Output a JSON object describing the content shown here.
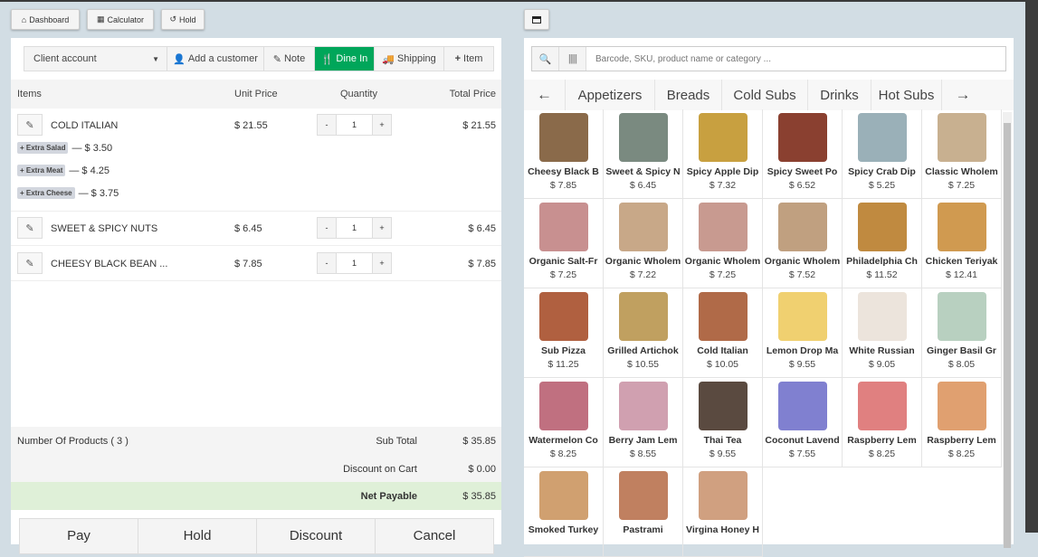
{
  "top_buttons": {
    "dashboard": "Dashboard",
    "calculator": "Calculator",
    "hold": "Hold"
  },
  "toolbar": {
    "client": "Client account",
    "add_customer": "Add a customer",
    "note": "Note",
    "dine_in": "Dine In",
    "shipping": "Shipping",
    "item": "Item"
  },
  "cart_headers": {
    "items": "Items",
    "unit_price": "Unit Price",
    "quantity": "Quantity",
    "total_price": "Total Price"
  },
  "cart_items": [
    {
      "name": "COLD ITALIAN",
      "unit": "$ 21.55",
      "qty": "1",
      "total": "$ 21.55",
      "extras": [
        {
          "label": "+ Extra Salad",
          "price": "— $ 3.50"
        },
        {
          "label": "+ Extra Meat",
          "price": "— $ 4.25"
        },
        {
          "label": "+ Extra Cheese",
          "price": "— $ 3.75"
        }
      ]
    },
    {
      "name": "SWEET & SPICY NUTS",
      "unit": "$ 6.45",
      "qty": "1",
      "total": "$ 6.45"
    },
    {
      "name": "CHEESY BLACK BEAN ...",
      "unit": "$ 7.85",
      "qty": "1",
      "total": "$ 7.85"
    }
  ],
  "qty_minus": "-",
  "qty_plus": "+",
  "summary": {
    "num_products": "Number Of Products ( 3 )",
    "subtotal_label": "Sub Total",
    "subtotal": "$ 35.85",
    "discount_label": "Discount on Cart",
    "discount": "$ 0.00",
    "net_label": "Net Payable",
    "net": "$ 35.85"
  },
  "bottom_buttons": [
    "Pay",
    "Hold",
    "Discount",
    "Cancel"
  ],
  "search": {
    "placeholder": "Barcode, SKU, product name or category ..."
  },
  "categories": [
    "Appetizers",
    "Breads",
    "Cold Subs",
    "Drinks",
    "Hot Subs"
  ],
  "products": [
    {
      "name": "Cheesy Black B",
      "price": "$ 7.85",
      "color": "#8a6a4a"
    },
    {
      "name": "Sweet & Spicy N",
      "price": "$ 6.45",
      "color": "#7a8a80"
    },
    {
      "name": "Spicy Apple Dip",
      "price": "$ 7.32",
      "color": "#c8a040"
    },
    {
      "name": "Spicy Sweet Po",
      "price": "$ 6.52",
      "color": "#8a4030"
    },
    {
      "name": "Spicy Crab Dip",
      "price": "$ 5.25",
      "color": "#9ab0b8"
    },
    {
      "name": "Classic Wholem",
      "price": "$ 7.25",
      "color": "#c8b090"
    },
    {
      "name": "Organic Salt-Fr",
      "price": "$ 7.25",
      "color": "#c89090"
    },
    {
      "name": "Organic Wholem",
      "price": "$ 7.22",
      "color": "#c8a888"
    },
    {
      "name": "Organic Wholem",
      "price": "$ 7.25",
      "color": "#c89a90"
    },
    {
      "name": "Organic Wholem",
      "price": "$ 7.52",
      "color": "#c0a080"
    },
    {
      "name": "Philadelphia Ch",
      "price": "$ 11.52",
      "color": "#c08a40"
    },
    {
      "name": "Chicken Teriyak",
      "price": "$ 12.41",
      "color": "#d09a50"
    },
    {
      "name": "Sub Pizza",
      "price": "$ 11.25",
      "color": "#b06040"
    },
    {
      "name": "Grilled Artichok",
      "price": "$ 10.55",
      "color": "#c0a060"
    },
    {
      "name": "Cold Italian",
      "price": "$ 10.05",
      "color": "#b06a48"
    },
    {
      "name": "Lemon Drop Ma",
      "price": "$ 9.55",
      "color": "#f0d070"
    },
    {
      "name": "White Russian",
      "price": "$ 9.05",
      "color": "#ece4dc"
    },
    {
      "name": "Ginger Basil Gr",
      "price": "$ 8.05",
      "color": "#b8d0c0"
    },
    {
      "name": "Watermelon Co",
      "price": "$ 8.25",
      "color": "#c07080"
    },
    {
      "name": "Berry Jam Lem",
      "price": "$ 8.55",
      "color": "#d0a0b0"
    },
    {
      "name": "Thai Tea",
      "price": "$ 9.55",
      "color": "#5a4a40"
    },
    {
      "name": "Coconut Lavend",
      "price": "$ 7.55",
      "color": "#8080d0"
    },
    {
      "name": "Raspberry Lem",
      "price": "$ 8.25",
      "color": "#e08080"
    },
    {
      "name": "Raspberry Lem",
      "price": "$ 8.25",
      "color": "#e0a070"
    },
    {
      "name": "Smoked Turkey",
      "price": "",
      "color": "#d0a070"
    },
    {
      "name": "Pastrami",
      "price": "",
      "color": "#c08060"
    },
    {
      "name": "Virgina Honey H",
      "price": "",
      "color": "#d0a080"
    }
  ]
}
